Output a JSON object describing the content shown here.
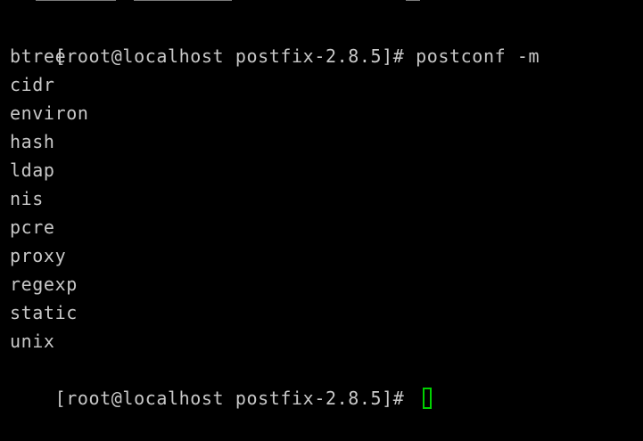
{
  "terminal": {
    "prompt": "[root@localhost postfix-2.8.5]# ",
    "command": "postconf -m",
    "output": [
      "btree",
      "cidr",
      "environ",
      "hash",
      "ldap",
      "nis",
      "pcre",
      "proxy",
      "regexp",
      "static",
      "unix"
    ],
    "final_prompt": "[root@localhost postfix-2.8.5]# "
  },
  "colors": {
    "background": "#000000",
    "text": "#c8c8c8",
    "cursor": "#00d200"
  }
}
